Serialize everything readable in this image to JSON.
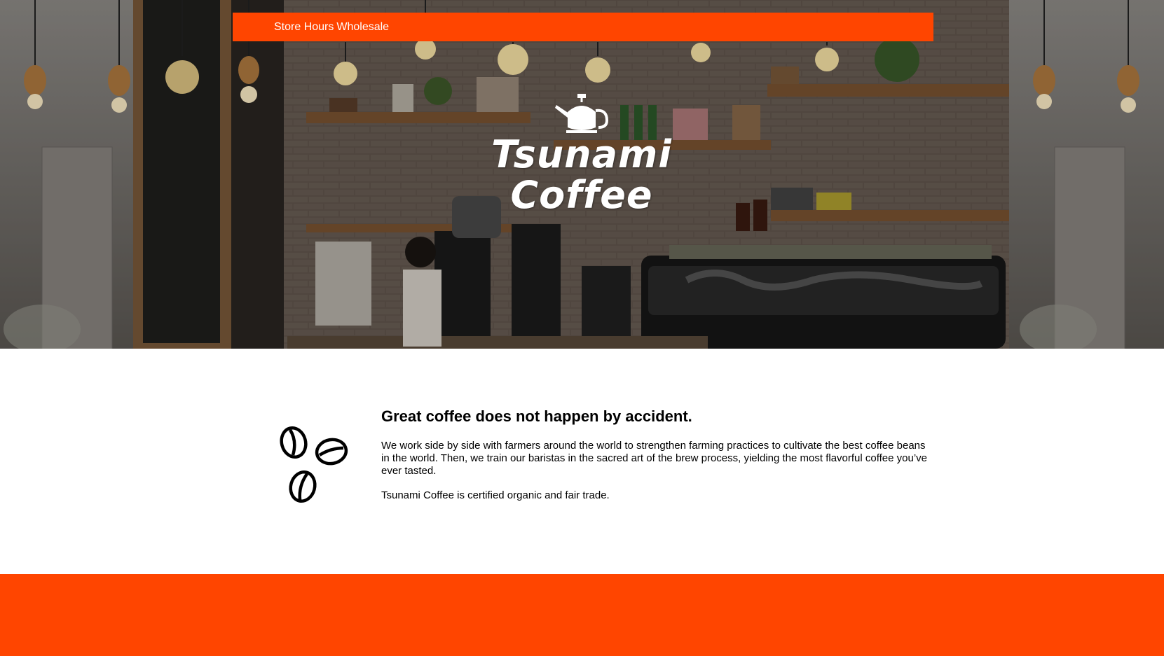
{
  "nav": {
    "links": [
      "Store Hours",
      "Wholesale"
    ]
  },
  "hero": {
    "logo_line1": "Tsunami",
    "logo_line2": "Coffee",
    "logo_icon": "coffee-kettle-icon"
  },
  "about": {
    "icon": "coffee-beans-icon",
    "title": "Great coffee does not happen by accident.",
    "paragraph1": "We work side by side with farmers around the world to strengthen farming practices to cultivate the best coffee beans in the world. Then, we train our baristas in the sacred art of the brew process, yielding the most flavorful coffee you’ve ever tasted.",
    "paragraph2": "Tsunami Coffee is certified organic and fair trade."
  },
  "colors": {
    "accent": "#ff4500",
    "text": "#000000",
    "background": "#ffffff"
  }
}
